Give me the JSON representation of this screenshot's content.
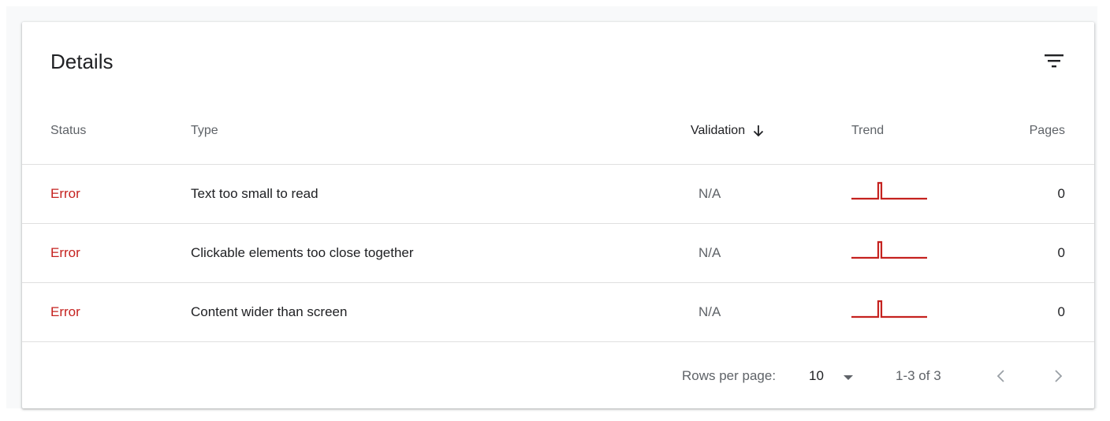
{
  "card": {
    "title": "Details",
    "filter_icon": "filter-list-icon"
  },
  "table": {
    "columns": {
      "status": "Status",
      "type": "Type",
      "validation": "Validation",
      "trend": "Trend",
      "pages": "Pages"
    },
    "sort_icon": "arrow-down-icon",
    "rows": [
      {
        "status": "Error",
        "type": "Text too small to read",
        "validation": "N/A",
        "pages": "0",
        "trend_color": "#c5221f"
      },
      {
        "status": "Error",
        "type": "Clickable elements too close together",
        "validation": "N/A",
        "pages": "0",
        "trend_color": "#c5221f"
      },
      {
        "status": "Error",
        "type": "Content wider than screen",
        "validation": "N/A",
        "pages": "0",
        "trend_color": "#c5221f"
      }
    ]
  },
  "footer": {
    "rows_per_page_label": "Rows per page:",
    "rows_per_page_value": "10",
    "range": "1-3 of 3",
    "prev_icon": "chevron-left-icon",
    "next_icon": "chevron-right-icon"
  },
  "colors": {
    "error": "#c5221f",
    "muted": "#5f6368",
    "text": "#202124"
  }
}
